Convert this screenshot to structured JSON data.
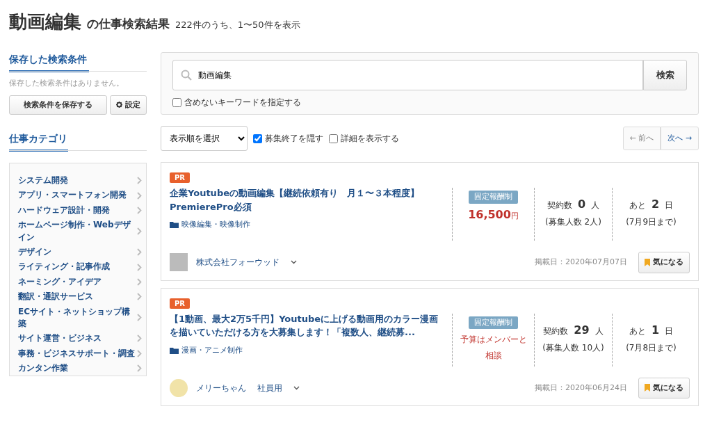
{
  "heading": {
    "keyword": "動画編集",
    "suffix": "の仕事検索結果",
    "count": "222件のうち、1〜50件を表示"
  },
  "saved_search": {
    "title": "保存した検索条件",
    "empty": "保存した検索条件はありません。",
    "save_button": "検索条件を保存する",
    "settings_button": "設定"
  },
  "categories": {
    "title": "仕事カテゴリ",
    "items": [
      {
        "label": "システム開発"
      },
      {
        "label": "アプリ・スマートフォン開発"
      },
      {
        "label": "ハードウェア設計・開発"
      },
      {
        "label": "ホームページ制作・Webデザイン"
      },
      {
        "label": "デザイン"
      },
      {
        "label": "ライティング・記事作成"
      },
      {
        "label": "ネーミング・アイデア"
      },
      {
        "label": "翻訳・通訳サービス"
      },
      {
        "label": "ECサイト・ネットショップ構築"
      },
      {
        "label": "サイト運営・ビジネス"
      },
      {
        "label": "事務・ビジネスサポート・調査"
      },
      {
        "label": "カンタン作業"
      }
    ]
  },
  "search": {
    "value": "動画編集",
    "button": "検索",
    "exclude": {
      "label": "含めないキーワードを指定する",
      "checked": false
    }
  },
  "toolbar": {
    "sort": "表示順を選択",
    "filters": [
      {
        "label": "募集終了を隠す",
        "checked": true
      },
      {
        "label": "詳細を表示する",
        "checked": false
      }
    ],
    "pager": [
      {
        "label": "← 前へ",
        "disabled": true
      },
      {
        "label": "次へ →",
        "disabled": false
      }
    ]
  },
  "jobs": [
    {
      "badge": "PR",
      "title": "企業Youtubeの動画編集【継続依頼有り　月１〜３本程度】PremierePro必須",
      "category": "映像編集・映像制作",
      "pay_type": "固定報酬制",
      "budget": {
        "kind": "amount",
        "amount": "16,500",
        "unit": "円"
      },
      "contracts": {
        "label": "契約数",
        "count": "0",
        "unit": "人",
        "sub": "(募集人数 2人)"
      },
      "deadline": {
        "label": "あと",
        "count": "2",
        "unit": "日",
        "sub": "(7月9日まで)"
      },
      "client": [
        "株式会社フォーウッド"
      ],
      "posted": "掲載日：2020年07月07日",
      "bookmark": "気になる"
    },
    {
      "badge": "PR",
      "title": "【1動画、最大2万5千円】Youtubeに上げる動画用のカラー漫画を描いていただける方を大募集します！「複数人、継続募...",
      "category": "漫画・アニメ制作",
      "pay_type": "固定報酬制",
      "budget": {
        "kind": "text",
        "text": "予算はメンバーと相談"
      },
      "contracts": {
        "label": "契約数",
        "count": "29",
        "unit": "人",
        "sub": "(募集人数 10人)"
      },
      "deadline": {
        "label": "あと",
        "count": "1",
        "unit": "日",
        "sub": "(7月8日まで)"
      },
      "client": [
        "メリーちゃん",
        "社員用"
      ],
      "posted": "掲載日：2020年06月24日",
      "bookmark": "気になる"
    }
  ]
}
